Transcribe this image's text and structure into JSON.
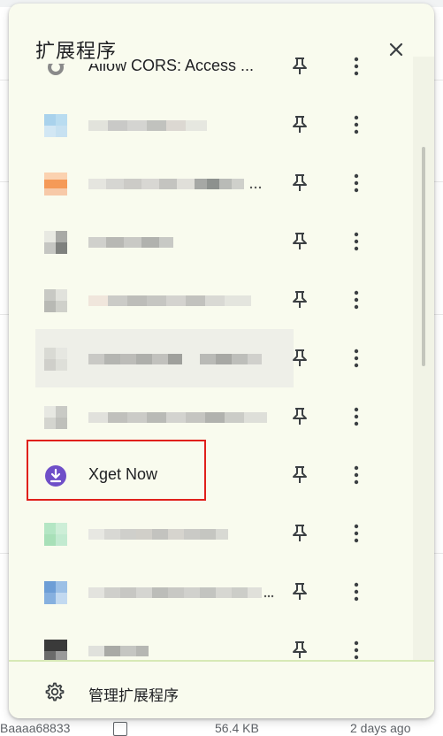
{
  "popup": {
    "title": "扩展程序",
    "close_icon": "close-icon"
  },
  "extensions": [
    {
      "name": "Allow CORS: Access ...",
      "blurred": false,
      "partial": true
    },
    {
      "name": "",
      "blurred": true
    },
    {
      "name": "",
      "blurred": true
    },
    {
      "name": "",
      "blurred": true
    },
    {
      "name": "",
      "blurred": true
    },
    {
      "name": "",
      "blurred": true
    },
    {
      "name": "",
      "blurred": true
    },
    {
      "name": "Xget Now",
      "blurred": false,
      "highlighted": true
    },
    {
      "name": "",
      "blurred": true
    },
    {
      "name": "",
      "blurred": true
    },
    {
      "name": "",
      "blurred": true
    }
  ],
  "footer": {
    "manage_label": "管理扩展程序"
  },
  "background": {
    "row": [
      "Baaaa68833",
      "56.4 KB",
      "2 days ago"
    ]
  },
  "colors": {
    "popup_bg": "#f9fbee",
    "highlight": "#e0201b",
    "xget_icon": "#6f4fc8"
  }
}
